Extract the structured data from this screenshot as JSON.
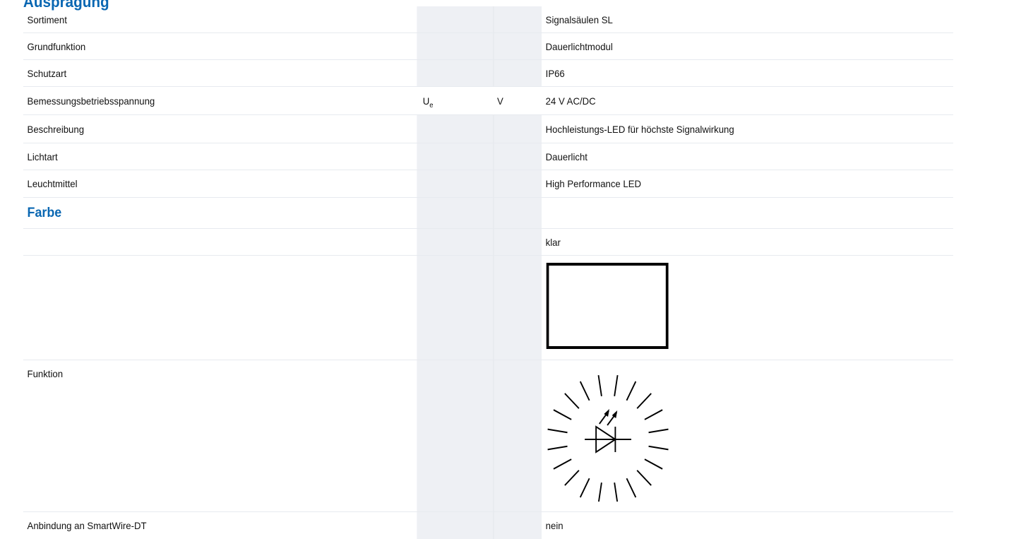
{
  "top_heading": "Ausprägung",
  "rows": [
    {
      "name": "Sortiment",
      "value": "Signalsäulen SL"
    },
    {
      "name": "Grundfunktion",
      "value": "Dauerlichtmodul"
    },
    {
      "name": "Schutzart",
      "value": "IP66"
    },
    {
      "name": "Bemessungsbetriebsspannung",
      "symbol": "U",
      "symbol_sub": "e",
      "unit": "V",
      "value": "24 V AC/DC"
    },
    {
      "name": "Beschreibung",
      "value": "Hochleistungs-LED für höchste Signalwirkung"
    },
    {
      "name": "Lichtart",
      "value": "Dauerlicht"
    },
    {
      "name": "Leuchtmittel",
      "value": "High Performance LED"
    }
  ],
  "section": {
    "title": "Farbe",
    "value": "klar"
  },
  "farbe_swatch": {
    "icon": "color-swatch-icon",
    "color": "#ffffff"
  },
  "funktion": {
    "name": "Funktion",
    "icon": "led-light-icon"
  },
  "anbindung": {
    "name": "Anbindung an SmartWire-DT",
    "value": "nein"
  },
  "colors": {
    "accent": "#0a67b2",
    "shade": "#eef0f4"
  }
}
